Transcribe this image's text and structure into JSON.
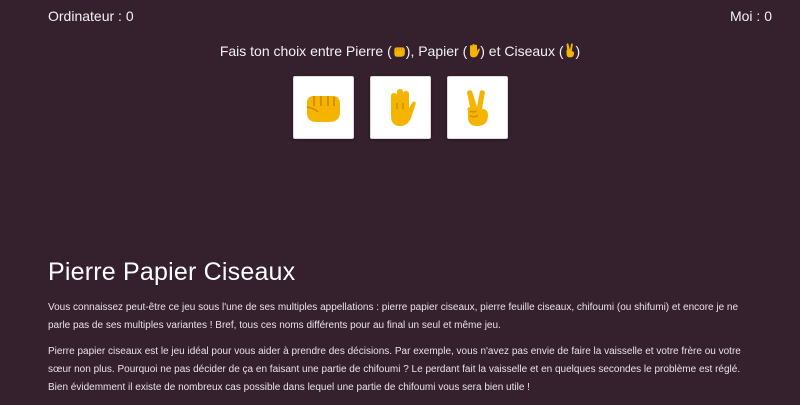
{
  "scoreboard": {
    "computer_label": "Ordinateur : 0",
    "player_label": "Moi : 0"
  },
  "prompt": {
    "text_start": "Fais ton choix entre Pierre (",
    "text_mid1": "), Papier (",
    "text_mid2": ") et Ciseaux (",
    "text_end": ")",
    "rock_icon": "fist-icon",
    "paper_icon": "hand-icon",
    "scissors_icon": "victory-hand-icon"
  },
  "choices": [
    {
      "name": "Pierre",
      "icon": "fist-icon"
    },
    {
      "name": "Papier",
      "icon": "hand-icon"
    },
    {
      "name": "Ciseaux",
      "icon": "victory-hand-icon"
    }
  ],
  "article": {
    "title": "Pierre Papier Ciseaux",
    "paragraphs": [
      "Vous connaissez peut-être ce jeu sous l'une de ses multiples appellations : pierre papier ciseaux, pierre feuille ciseaux, chifoumi (ou shifumi) et encore je ne parle pas de ses multiples variantes ! Bref, tous ces noms différents pour au final un seul et même jeu.",
      "Pierre papier ciseaux est le jeu idéal pour vous aider à prendre des décisions. Par exemple, vous n'avez pas envie de faire la vaisselle et votre frère ou votre sœur non plus. Pourquoi ne pas décider de ça en faisant une partie de chifoumi ? Le perdant fait la vaisselle et en quelques secondes le problème est réglé. Bien évidemment il existe de nombreux cas possible dans lequel une partie de chifoumi vous sera bien utile !"
    ]
  },
  "colors": {
    "background": "#35202d",
    "emoji": "#f4b400"
  }
}
